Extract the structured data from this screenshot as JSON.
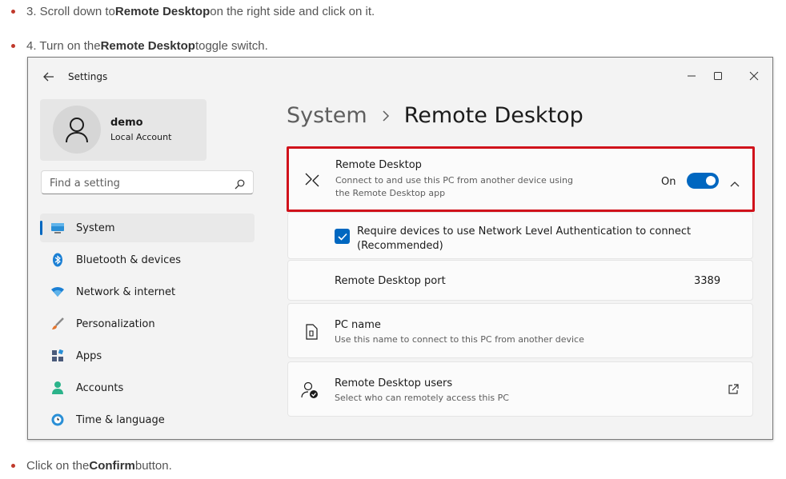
{
  "instructions": {
    "step3": {
      "prefix": "3. Scroll down to ",
      "bold": "Remote Desktop",
      "suffix": " on the right side and click on it."
    },
    "step4": {
      "prefix": "4. Turn on the ",
      "bold": "Remote Desktop",
      "suffix": " toggle switch."
    },
    "step5": {
      "prefix": "Click on the ",
      "bold": "Confirm",
      "suffix": " button."
    }
  },
  "window": {
    "title": "Settings",
    "back_icon": "arrow-left-icon",
    "controls": [
      "minimize-icon",
      "maximize-icon",
      "close-icon"
    ]
  },
  "profile": {
    "name": "demo",
    "account_type": "Local Account"
  },
  "search": {
    "placeholder": "Find a setting"
  },
  "nav": {
    "items": [
      {
        "label": "System",
        "icon": "monitor-icon",
        "active": true
      },
      {
        "label": "Bluetooth & devices",
        "icon": "bluetooth-icon"
      },
      {
        "label": "Network & internet",
        "icon": "wifi-icon"
      },
      {
        "label": "Personalization",
        "icon": "brush-icon"
      },
      {
        "label": "Apps",
        "icon": "apps-icon"
      },
      {
        "label": "Accounts",
        "icon": "person-icon"
      },
      {
        "label": "Time & language",
        "icon": "clock-globe-icon"
      }
    ]
  },
  "breadcrumb": {
    "parent": "System",
    "current": "Remote Desktop"
  },
  "remote_desktop": {
    "title": "Remote Desktop",
    "desc_line1": "Connect to and use this PC from another device using",
    "desc_line2": "the Remote Desktop app",
    "state_label": "On",
    "enabled": true
  },
  "nla": {
    "line1": "Require devices to use Network Level Authentication to connect",
    "line2": "(Recommended)",
    "checked": true
  },
  "port": {
    "label": "Remote Desktop port",
    "value": "3389"
  },
  "pc_name": {
    "title": "PC name",
    "desc": "Use this name to connect to this PC from another device"
  },
  "rd_users": {
    "title": "Remote Desktop users",
    "desc": "Select who can remotely access this PC"
  },
  "colors": {
    "accent": "#0067c0",
    "highlight_border": "#d0121b",
    "bullet": "#c0392b"
  }
}
